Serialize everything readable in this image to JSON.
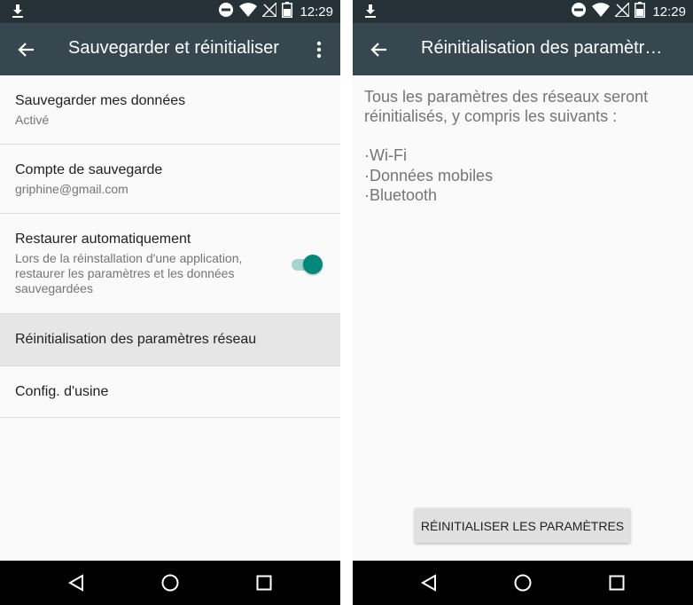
{
  "status": {
    "time": "12:29"
  },
  "left": {
    "toolbar": {
      "title": "Sauvegarder et réinitialiser"
    },
    "items": [
      {
        "title": "Sauvegarder mes données",
        "subtitle": "Activé"
      },
      {
        "title": "Compte de sauvegarde",
        "subtitle": "griphine@gmail.com"
      },
      {
        "title": "Restaurer automatiquement",
        "subtitle": "Lors de la réinstallation d'une application, restaurer les paramètres et les données sauvegardées",
        "toggle_on": true
      },
      {
        "title": "Réinitialisation des paramètres réseau"
      },
      {
        "title": "Config. d'usine"
      }
    ]
  },
  "right": {
    "toolbar": {
      "title": "Réinitialisation des paramètres réseau"
    },
    "description": "Tous les paramètres des réseaux seront réinitialisés, y compris les suivants :",
    "bullets": [
      "·Wi-Fi",
      "·Données mobiles",
      "·Bluetooth"
    ],
    "button_label": "RÉINITIALISER LES PARAMÈTRES"
  },
  "colors": {
    "accent": "#00897b",
    "toolbar": "#37474f",
    "statusbar": "#263238"
  }
}
